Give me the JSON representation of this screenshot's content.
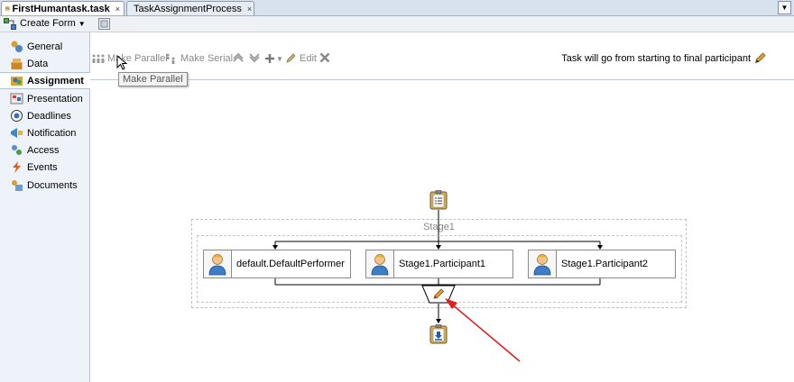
{
  "tabs": [
    {
      "label": "FirstHumantask.task",
      "active": true
    },
    {
      "label": "TaskAssignmentProcess",
      "active": false
    }
  ],
  "tab_close": "×",
  "form_toolbar": {
    "create_form_label": "Create Form"
  },
  "nav": {
    "items": [
      {
        "label": "General",
        "icon": "general-icon"
      },
      {
        "label": "Data",
        "icon": "data-icon"
      },
      {
        "label": "Assignment",
        "icon": "assignment-icon",
        "selected": true
      },
      {
        "label": "Presentation",
        "icon": "presentation-icon"
      },
      {
        "label": "Deadlines",
        "icon": "deadlines-icon"
      },
      {
        "label": "Notification",
        "icon": "notification-icon"
      },
      {
        "label": "Access",
        "icon": "access-icon"
      },
      {
        "label": "Events",
        "icon": "events-icon"
      },
      {
        "label": "Documents",
        "icon": "documents-icon"
      }
    ]
  },
  "toolbar": {
    "make_parallel_label": "Make Parallel",
    "make_serial_label": "Make Serial",
    "edit_label": "Edit",
    "tooltip": "Make Parallel",
    "description": "Task will go from starting to final participant"
  },
  "diagram": {
    "stage_label": "Stage1",
    "participants": [
      {
        "label": "default.DefaultPerformer"
      },
      {
        "label": "Stage1.Participant1"
      },
      {
        "label": "Stage1.Participant2"
      }
    ]
  },
  "colors": {
    "annotation_arrow": "#e02020",
    "accent": "#1e5fa8"
  }
}
